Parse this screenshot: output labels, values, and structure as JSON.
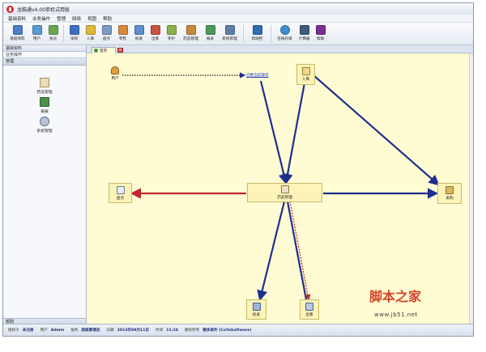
{
  "app": {
    "title": "龙脑通v4.00单机试用版"
  },
  "menu": [
    "基础资料",
    "业务操作",
    "管理",
    "网络",
    "视图",
    "帮助"
  ],
  "toolbar": {
    "groups": [
      [
        {
          "label": "基础资料",
          "color": "#4d7fc8"
        },
        {
          "label": "用户",
          "color": "#5a9bd5"
        },
        {
          "label": "会员",
          "color": "#6aa84f"
        }
      ],
      [
        {
          "label": "采购",
          "color": "#3f6ebf"
        },
        {
          "label": "入库",
          "color": "#e0b93a"
        },
        {
          "label": "盘点",
          "color": "#7d9cc4"
        },
        {
          "label": "零售",
          "color": "#d88b3d"
        },
        {
          "label": "批发",
          "color": "#5b8fd0"
        },
        {
          "label": "出库",
          "color": "#c9553b"
        },
        {
          "label": "奖护",
          "color": "#8ab24a"
        },
        {
          "label": "药品管理",
          "color": "#c68a3a"
        },
        {
          "label": "报表",
          "color": "#4a9a5c"
        },
        {
          "label": "系统管理",
          "color": "#5d7fa8"
        }
      ],
      [
        {
          "label": "帮助档",
          "color": "#2e6db4"
        }
      ],
      [
        {
          "label": "在线升级",
          "color": "#3a8ed4"
        },
        {
          "label": "计算器",
          "color": "#3d5b7a"
        },
        {
          "label": "帮助",
          "color": "#7b2f8f"
        }
      ]
    ]
  },
  "sidebar": {
    "header": "基础资料",
    "sub": "业务操作",
    "section": "管理",
    "items": [
      {
        "label": "药品管理",
        "icon": "pill-bottle-icon",
        "color": "#d9c7a4"
      },
      {
        "label": "报表",
        "icon": "report-icon",
        "color": "#4a8f4a"
      },
      {
        "label": "系统管理",
        "icon": "system-gear-icon",
        "color": "#8a9ab4"
      }
    ],
    "bottom": "帮助"
  },
  "tab": {
    "label": "首页"
  },
  "diagram": {
    "user_label": "用户",
    "user_link": "切换当前操作",
    "nodes": {
      "in": "入库",
      "center": "药品管理",
      "buy": "采购",
      "check": "盘点",
      "sale": "批发",
      "out": "出库"
    }
  },
  "status": {
    "items": [
      {
        "label": "授权于",
        "value": "未注册"
      },
      {
        "label": "用户",
        "value": "Admin"
      },
      {
        "label": "角色",
        "value": "超级管理员"
      },
      {
        "label": "日期",
        "value": "2013年09月11日"
      },
      {
        "label": "时间",
        "value": "11:24"
      },
      {
        "label": "版权所有",
        "value": "微多软件 (CoYoSoftware)"
      }
    ]
  },
  "watermark": {
    "text": "脚本之家",
    "url": "www.jb51.net"
  },
  "colors": {
    "arrow": "#1f2f8f",
    "arrow_red": "#c0272d",
    "canvas": "#fffbd3"
  }
}
